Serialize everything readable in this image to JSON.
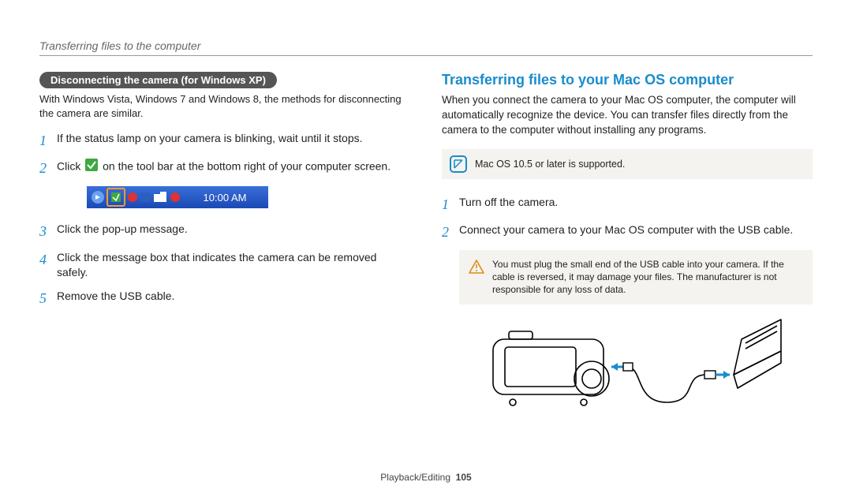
{
  "header": "Transferring files to the computer",
  "left": {
    "pill": "Disconnecting the camera (for Windows XP)",
    "subtext": "With Windows Vista, Windows 7 and Windows 8, the methods for disconnecting the camera are similar.",
    "steps": [
      "If the status lamp on your camera is blinking, wait until it stops.",
      "Click |ICON| on the tool bar at the bottom right of your computer screen.",
      "Click the pop-up message.",
      "Click the message box that indicates the camera can be removed safely.",
      "Remove the USB cable."
    ],
    "tray_time": "10:00 AM"
  },
  "right": {
    "title": "Transferring files to your Mac OS computer",
    "intro": "When you connect the camera to your Mac OS computer, the computer will automatically recognize the device. You can transfer files directly from the camera to the computer without installing any programs.",
    "note": "Mac OS 10.5 or later is supported.",
    "steps": [
      "Turn off the camera.",
      "Connect your camera to your Mac OS computer with the USB cable."
    ],
    "warning": "You must plug the small end of the USB cable into your camera. If the cable is reversed, it may damage your files. The manufacturer is not responsible for any loss of data."
  },
  "footer": {
    "section": "Playback/Editing",
    "page": "105"
  }
}
